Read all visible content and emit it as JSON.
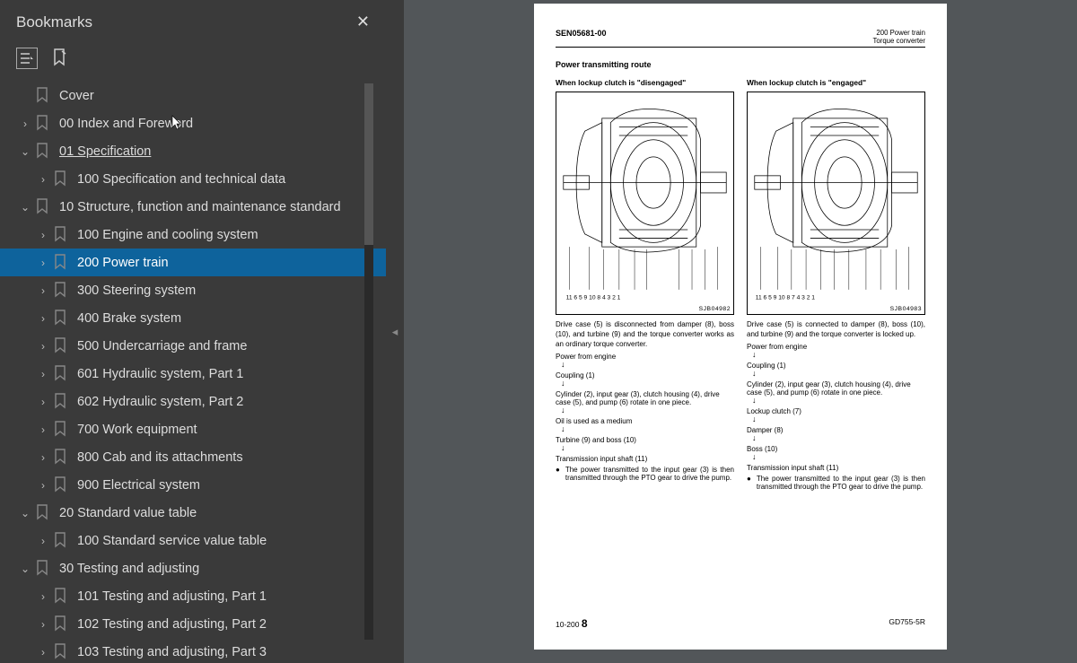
{
  "sidebar": {
    "title": "Bookmarks",
    "items": [
      {
        "indent": 0,
        "chev": "",
        "label": "Cover",
        "sel": false
      },
      {
        "indent": 0,
        "chev": "›",
        "label": "00 Index and Foreword",
        "sel": false
      },
      {
        "indent": 0,
        "chev": "⌄",
        "label": "01 Specification",
        "sel": false,
        "ul": true
      },
      {
        "indent": 1,
        "chev": "›",
        "label": "100 Specification and technical data",
        "sel": false
      },
      {
        "indent": 0,
        "chev": "⌄",
        "label": "10 Structure, function and maintenance standard",
        "sel": false
      },
      {
        "indent": 1,
        "chev": "›",
        "label": "100 Engine and cooling system",
        "sel": false
      },
      {
        "indent": 1,
        "chev": "›",
        "label": "200 Power train",
        "sel": true
      },
      {
        "indent": 1,
        "chev": "›",
        "label": "300 Steering system",
        "sel": false
      },
      {
        "indent": 1,
        "chev": "›",
        "label": "400 Brake system",
        "sel": false
      },
      {
        "indent": 1,
        "chev": "›",
        "label": "500 Undercarriage and frame",
        "sel": false
      },
      {
        "indent": 1,
        "chev": "›",
        "label": "601 Hydraulic system, Part 1",
        "sel": false
      },
      {
        "indent": 1,
        "chev": "›",
        "label": "602 Hydraulic system, Part 2",
        "sel": false
      },
      {
        "indent": 1,
        "chev": "›",
        "label": "700 Work equipment",
        "sel": false
      },
      {
        "indent": 1,
        "chev": "›",
        "label": "800 Cab and its attachments",
        "sel": false
      },
      {
        "indent": 1,
        "chev": "›",
        "label": "900 Electrical system",
        "sel": false
      },
      {
        "indent": 0,
        "chev": "⌄",
        "label": "20 Standard value table",
        "sel": false
      },
      {
        "indent": 1,
        "chev": "›",
        "label": "100 Standard service value table",
        "sel": false
      },
      {
        "indent": 0,
        "chev": "⌄",
        "label": "30 Testing and adjusting",
        "sel": false
      },
      {
        "indent": 1,
        "chev": "›",
        "label": "101 Testing and adjusting, Part 1",
        "sel": false
      },
      {
        "indent": 1,
        "chev": "›",
        "label": "102 Testing and adjusting, Part 2",
        "sel": false
      },
      {
        "indent": 1,
        "chev": "›",
        "label": "103 Testing and adjusting, Part 3",
        "sel": false
      }
    ]
  },
  "doc": {
    "docId": "SEN05681-00",
    "headerRight1": "200 Power train",
    "headerRight2": "Torque converter",
    "sectionTitle": "Power transmitting route",
    "left": {
      "subhead": "When lockup clutch is \"disengaged\"",
      "diagCode": "SJB04982",
      "diagLabels": "11  6   5   9   10  8           4    3   2   1",
      "desc": "Drive case (5) is disconnected from damper (8), boss (10), and turbine (9) and the torque converter works as an ordinary torque converter.",
      "flow": [
        "Power from engine",
        "↓",
        "Coupling (1)",
        "↓",
        "Cylinder (2), input gear (3), clutch housing (4), drive case (5), and pump (6) rotate in one piece.",
        "↓",
        "Oil is used as a medium",
        "↓",
        "Turbine (9) and boss (10)",
        "↓",
        "Transmission input shaft (11)"
      ],
      "bullet": "The power transmitted to the input gear (3) is then transmitted through the PTO gear to drive the pump."
    },
    "right": {
      "subhead": "When lockup clutch is \"engaged\"",
      "diagCode": "SJB04983",
      "diagLabels": "11  6   5   9   10  8   7   4   3   2   1",
      "desc": "Drive case (5) is connected to damper (8), boss (10), and turbine (9) and the torque converter is locked up.",
      "flow": [
        "Power from engine",
        "↓",
        "Coupling (1)",
        "↓",
        "Cylinder (2), input gear (3), clutch housing (4), drive case (5), and pump (6) rotate in one piece.",
        "↓",
        "Lockup clutch (7)",
        "↓",
        "Damper (8)",
        "↓",
        "Boss (10)",
        "↓",
        "Transmission input shaft (11)"
      ],
      "bullet": "The power transmitted to the input gear (3) is then transmitted through the PTO gear to drive the pump."
    },
    "footerLeft": "10-200",
    "footerPage": "8",
    "footerRight": "GD755-5R"
  }
}
